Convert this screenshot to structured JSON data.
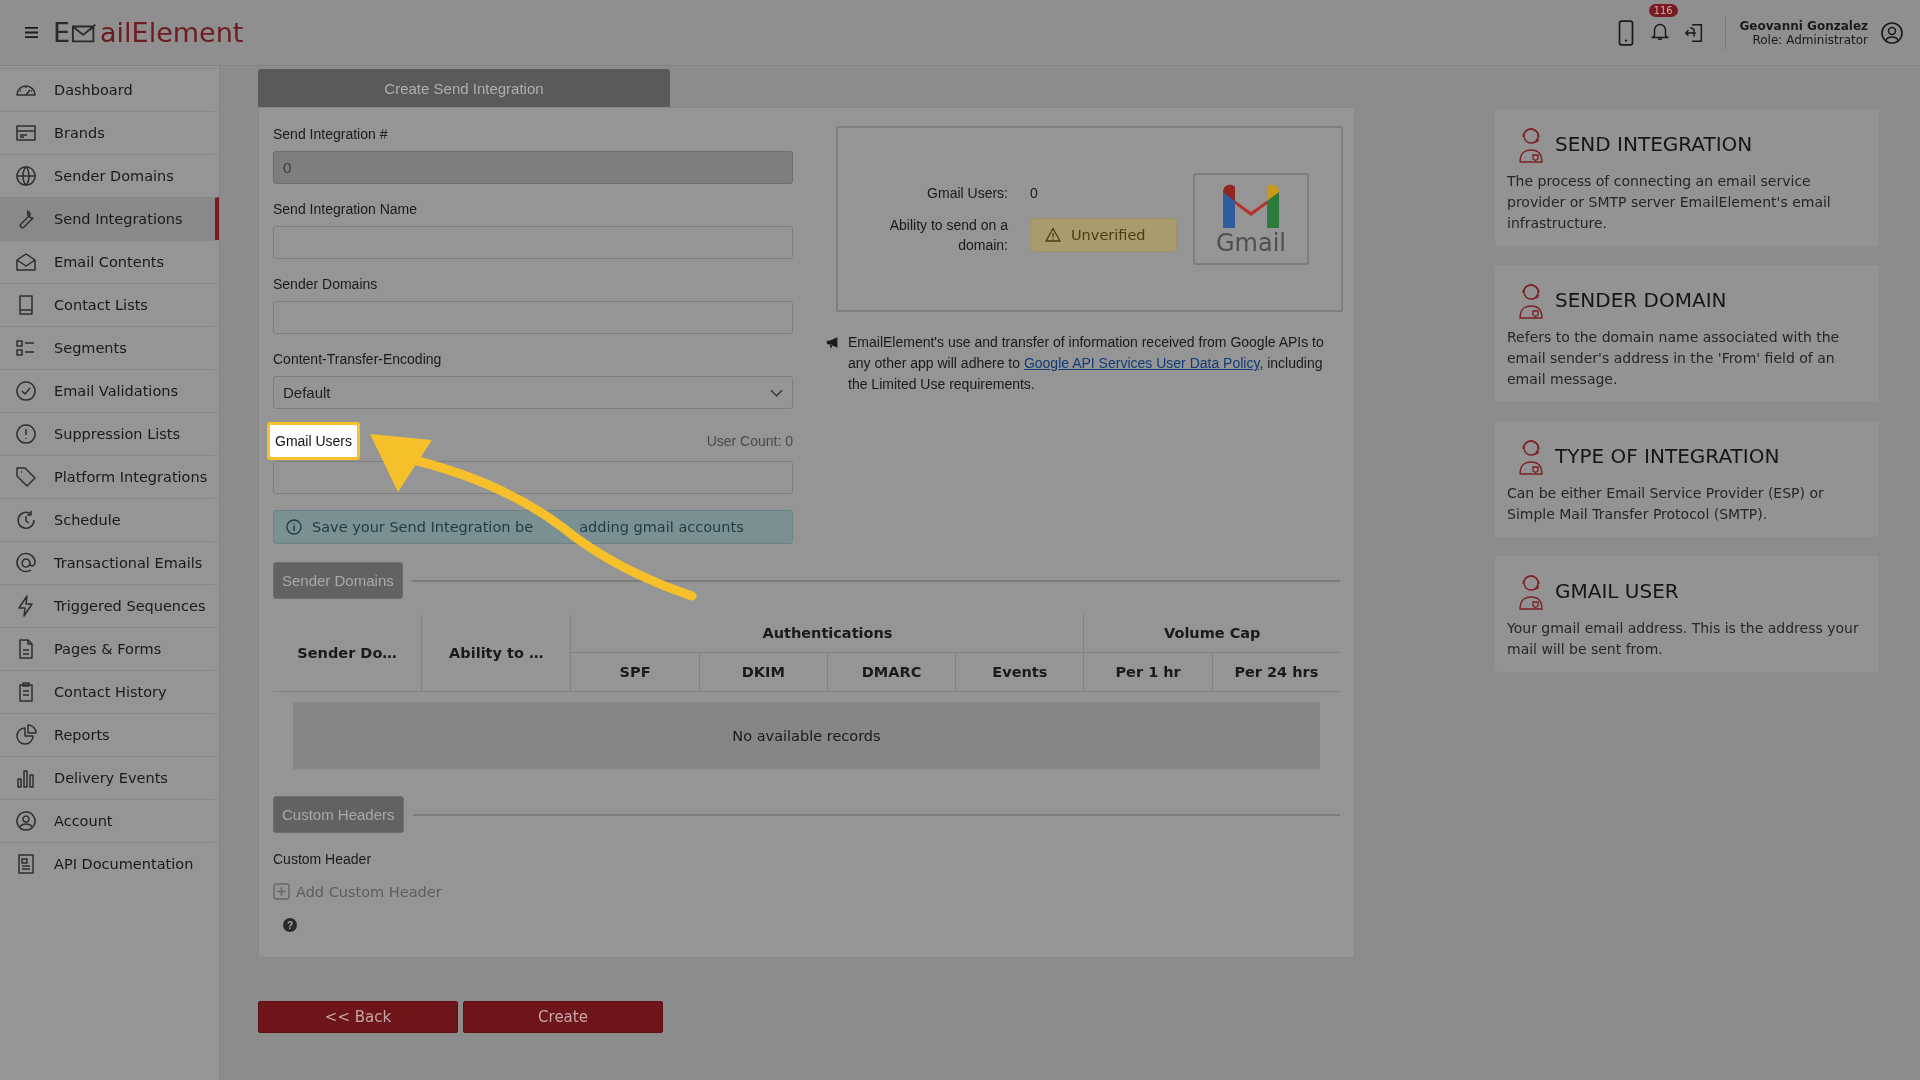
{
  "header": {
    "logo_before_icon": "E",
    "logo_after_icon": "ailElement",
    "notification_count": "116",
    "user_name": "Geovanni Gonzalez",
    "user_role": "Role: Administrator"
  },
  "sidebar": {
    "items": [
      {
        "label": "Dashboard",
        "selected": false
      },
      {
        "label": "Brands",
        "selected": false
      },
      {
        "label": "Sender Domains",
        "selected": false
      },
      {
        "label": "Send Integrations",
        "selected": true
      },
      {
        "label": "Email Contents",
        "selected": false
      },
      {
        "label": "Contact Lists",
        "selected": false
      },
      {
        "label": "Segments",
        "selected": false
      },
      {
        "label": "Email Validations",
        "selected": false
      },
      {
        "label": "Suppression Lists",
        "selected": false
      },
      {
        "label": "Platform Integrations",
        "selected": false
      },
      {
        "label": "Schedule",
        "selected": false
      },
      {
        "label": "Transactional Emails",
        "selected": false
      },
      {
        "label": "Triggered Sequences",
        "selected": false
      },
      {
        "label": "Pages & Forms",
        "selected": false
      },
      {
        "label": "Contact History",
        "selected": false
      },
      {
        "label": "Reports",
        "selected": false
      },
      {
        "label": "Delivery Events",
        "selected": false
      },
      {
        "label": "Account",
        "selected": false
      },
      {
        "label": "API Documentation",
        "selected": false
      }
    ]
  },
  "form": {
    "tab": "Create Send Integration",
    "fields": [
      {
        "kind": "input",
        "label": "Send Integration #",
        "value": "0",
        "disabled": true
      },
      {
        "kind": "input",
        "label": "Send Integration Name",
        "disabled": false
      },
      {
        "kind": "input",
        "label": "Sender Domains",
        "disabled": false
      },
      {
        "kind": "select",
        "label": "Content-Transfer-Encoding",
        "value": "Default",
        "disabled": false
      }
    ],
    "gmail_users": {
      "label": "Gmail Users",
      "highlighted": true,
      "count": "User Count: 0"
    },
    "alert": {
      "before_arrow": "Save your Send Integration be",
      "after_arrow": "adding gmail accounts"
    },
    "gmail_box": {
      "users_label": "Gmail Users:",
      "users_value": "0",
      "ability_label": "Ability to send on a domain:",
      "ability_value": "Unverified",
      "logo_text": "Gmail"
    },
    "notice": {
      "before": "EmailElement's use and transfer of information received from Google APIs to any other app will adhere to ",
      "link": "Google API Services User Data Policy",
      "after": ", including the Limited Use requirements."
    },
    "sender_domains_section": "Sender Domains",
    "table": {
      "columns": [
        "Sender Do…",
        "Ability to …"
      ],
      "groups": [
        {
          "label": "Authentications",
          "columns": [
            "SPF",
            "DKIM",
            "DMARC",
            "Events"
          ]
        },
        {
          "label": "Volume Cap",
          "columns": [
            "Per 1 hr",
            "Per 24 hrs"
          ]
        }
      ],
      "empty_text": "No available records"
    },
    "custom_headers_section": "Custom Headers",
    "custom_header_label": "Custom Header",
    "add_custom_header": "Add Custom Header",
    "help_icon": "?"
  },
  "buttons": [
    "<< Back",
    "Create"
  ],
  "info_panels": [
    {
      "title": "SEND INTEGRATION",
      "text": "The process of connecting an email service provider or SMTP server EmailElement's email infrastructure."
    },
    {
      "title": "SENDER DOMAIN",
      "text": "Refers to the domain name associated with the email sender's address in the 'From' field of an email message."
    },
    {
      "title": "TYPE OF INTEGRATION",
      "text": "Can be either Email Service Provider (ESP) or Simple Mail Transfer Protocol (SMTP)."
    },
    {
      "title": "GMAIL USER",
      "text": "Your gmail email address. This is the address your mail will be sent from."
    }
  ]
}
